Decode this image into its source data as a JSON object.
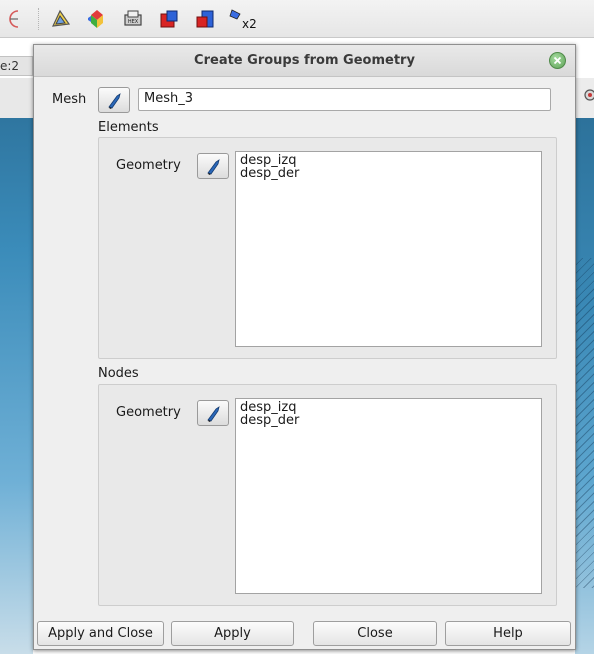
{
  "background": {
    "partial_tab_text": "e:2"
  },
  "dialog": {
    "title": "Create Groups from Geometry",
    "mesh": {
      "label": "Mesh",
      "value": "Mesh_3"
    },
    "elements": {
      "label": "Elements",
      "geometry_label": "Geometry",
      "items": [
        "desp_izq",
        "desp_der"
      ]
    },
    "nodes": {
      "label": "Nodes",
      "geometry_label": "Geometry",
      "items": [
        "desp_izq",
        "desp_der"
      ]
    },
    "buttons": {
      "apply_close": "Apply and Close",
      "apply": "Apply",
      "close": "Close",
      "help": "Help"
    }
  },
  "colors": {
    "dialog_bg": "#efefef",
    "titlebar_close": "#5ea257",
    "viewport_blue": "#3b8cba"
  },
  "icons": [
    "geometry-mode-icon",
    "color-palette-icon",
    "hex-mesh-icon",
    "red-block-icon",
    "blue-block-icon",
    "x2-tool-icon",
    "selection-arrow-icon",
    "close-icon"
  ]
}
